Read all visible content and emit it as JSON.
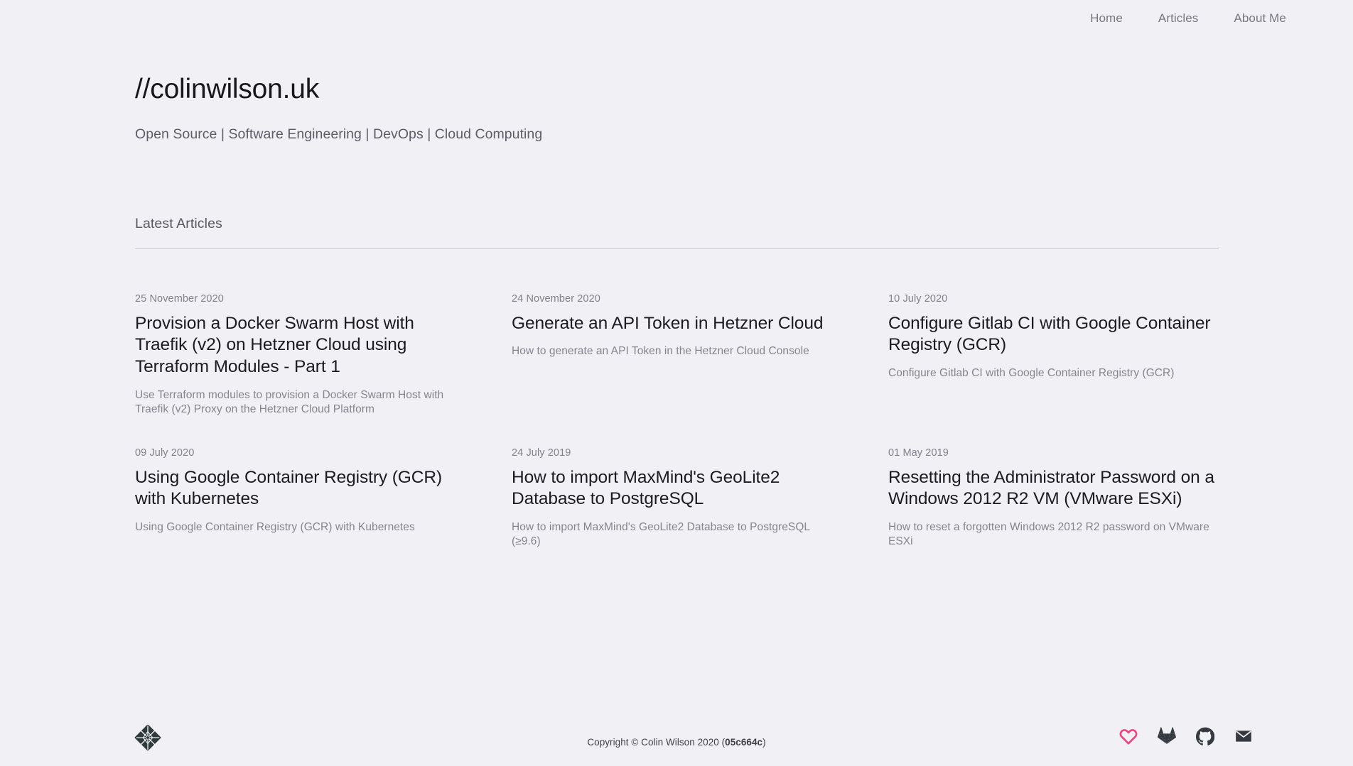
{
  "colors": {
    "background": "#f1f0f4",
    "heading": "#17171c",
    "muted": "#83818c",
    "rule": "#c9c6d0",
    "heart": "#f4407f",
    "icon_dark": "#343a40",
    "logo": "#2f3a3a"
  },
  "nav": {
    "items": [
      {
        "label": "Home"
      },
      {
        "label": "Articles"
      },
      {
        "label": "About Me"
      }
    ]
  },
  "masthead": {
    "title": "//colinwilson.uk",
    "tagline": "Open Source | Software Engineering | DevOps | Cloud Computing"
  },
  "section": {
    "title": "Latest Articles"
  },
  "articles": [
    {
      "date": "25 November 2020",
      "title": "Provision a Docker Swarm Host with Traefik (v2) on Hetzner Cloud using Terraform Modules - Part 1",
      "excerpt": "Use Terraform modules to provision a Docker Swarm Host with Traefik (v2) Proxy on the Hetzner Cloud Platform"
    },
    {
      "date": "24 November 2020",
      "title": "Generate an API Token in Hetzner Cloud",
      "excerpt": "How to generate an API Token in the Hetzner Cloud Console"
    },
    {
      "date": "10 July 2020",
      "title": "Configure Gitlab CI with Google Container Registry (GCR)",
      "excerpt": "Configure Gitlab CI with Google Container Registry (GCR)"
    },
    {
      "date": "09 July 2020",
      "title": "Using Google Container Registry (GCR) with Kubernetes",
      "excerpt": "Using Google Container Registry (GCR) with Kubernetes"
    },
    {
      "date": "24 July 2019",
      "title": "How to import MaxMind's GeoLite2 Database to PostgreSQL",
      "excerpt": "How to import MaxMind's GeoLite2 Database to PostgreSQL (≥9.6)"
    },
    {
      "date": "01 May 2019",
      "title": "Resetting the Administrator Password on a Windows 2012 R2 VM (VMware ESXi)",
      "excerpt": "How to reset a forgotten Windows 2012 R2 password on VMware ESXi"
    }
  ],
  "footer": {
    "logo_icon": "netlify-diamond-logo-icon",
    "copyright_prefix": "Copyright © Colin Wilson 2020 (",
    "copyright_hash": "05c664c",
    "copyright_suffix": ")",
    "social": [
      {
        "icon": "heart-icon",
        "label": "Sponsor"
      },
      {
        "icon": "gitlab-icon",
        "label": "GitLab"
      },
      {
        "icon": "github-icon",
        "label": "GitHub"
      },
      {
        "icon": "email-icon",
        "label": "Email"
      }
    ]
  }
}
